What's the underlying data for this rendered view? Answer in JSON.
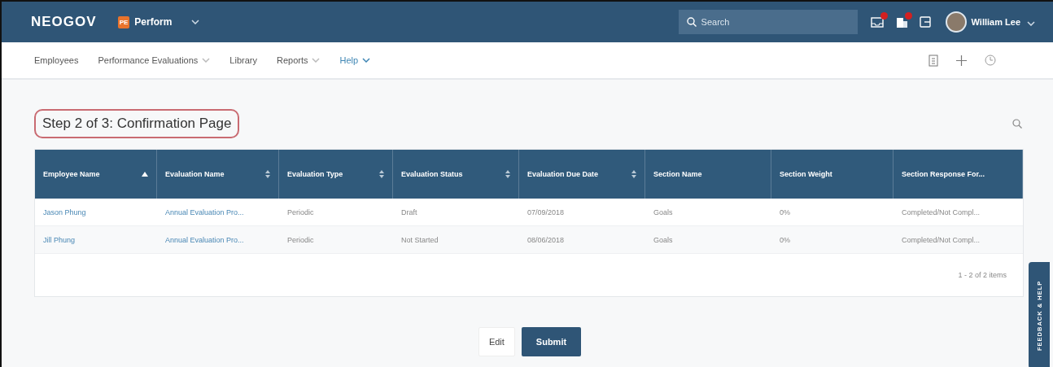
{
  "header": {
    "brand": "NEOGOV",
    "product_badge": "PE",
    "product": "Perform",
    "search": {
      "placeholder": "Search"
    },
    "user": "William Lee"
  },
  "nav": [
    {
      "label": "Employees",
      "dropdown": false,
      "selected": false
    },
    {
      "label": "Performance Evaluations",
      "dropdown": true,
      "selected": false
    },
    {
      "label": "Library",
      "dropdown": false,
      "selected": false
    },
    {
      "label": "Reports",
      "dropdown": true,
      "selected": false
    },
    {
      "label": "Help",
      "dropdown": true,
      "selected": true
    }
  ],
  "page_title": "Step 2 of 3: Confirmation Page",
  "table": {
    "columns": [
      {
        "label": "Employee Name",
        "sortable": true,
        "sorted": true,
        "kind": "link"
      },
      {
        "label": "Evaluation Name",
        "sortable": true,
        "sorted": false,
        "kind": "link"
      },
      {
        "label": "Evaluation Type",
        "sortable": true,
        "sorted": false,
        "kind": "text"
      },
      {
        "label": "Evaluation Status",
        "sortable": true,
        "sorted": false,
        "kind": "text"
      },
      {
        "label": "Evaluation Due Date",
        "sortable": true,
        "sorted": false,
        "kind": "text"
      },
      {
        "label": "Section Name",
        "sortable": false,
        "sorted": false,
        "kind": "text"
      },
      {
        "label": "Section Weight",
        "sortable": false,
        "sorted": false,
        "kind": "text"
      },
      {
        "label": "Section Response For...",
        "sortable": false,
        "sorted": false,
        "kind": "text"
      }
    ],
    "rows": [
      [
        "Jason Phung",
        "Annual Evaluation Pro...",
        "Periodic",
        "Draft",
        "07/09/2018",
        "Goals",
        "0%",
        "Completed/Not Compl..."
      ],
      [
        "Jill Phung",
        "Annual Evaluation Pro...",
        "Periodic",
        "Not Started",
        "08/06/2018",
        "Goals",
        "0%",
        "Completed/Not Compl..."
      ]
    ],
    "pager": "1 - 2 of 2 items"
  },
  "buttons": [
    {
      "label": "Edit",
      "kind": "secondary"
    },
    {
      "label": "Submit",
      "kind": "primary"
    }
  ],
  "feedback_tab": "FEEDBACK & HELP"
}
